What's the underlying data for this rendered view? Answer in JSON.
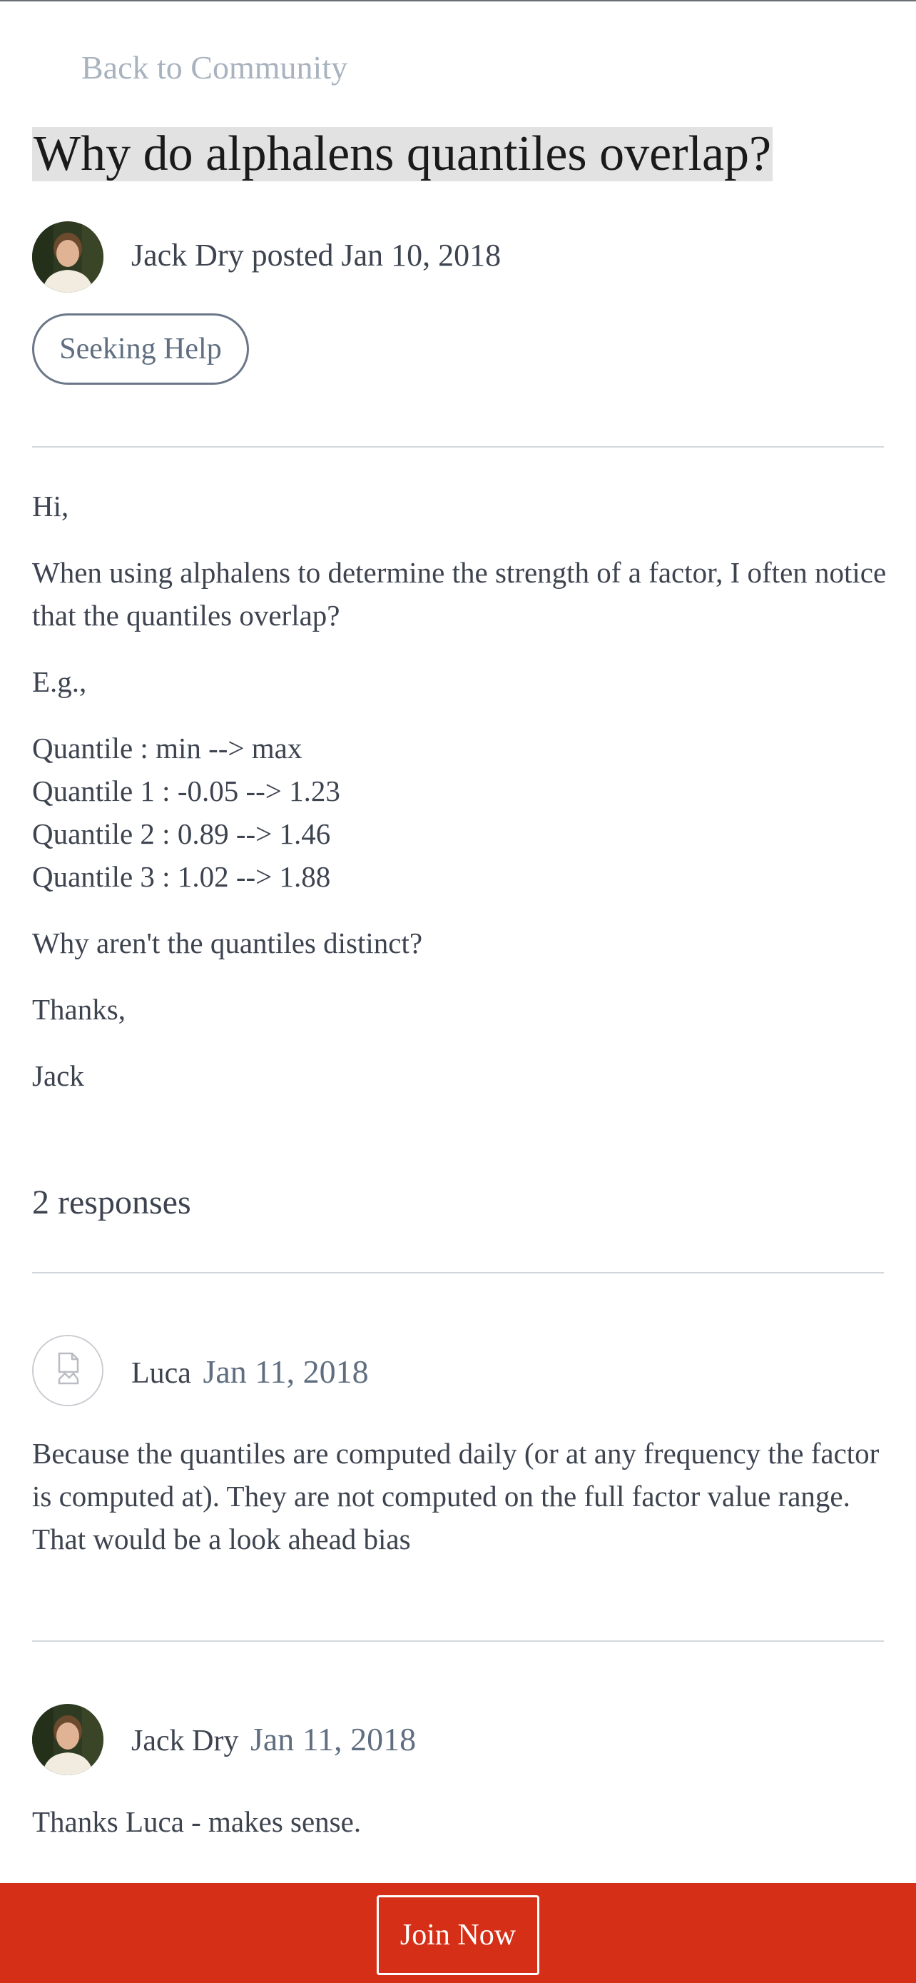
{
  "nav": {
    "back_label": "Back to Community"
  },
  "post": {
    "title": "Why do alphalens quantiles overlap?",
    "byline": "Jack Dry posted Jan 10, 2018",
    "tag": "Seeking Help",
    "paragraphs": {
      "p0": "Hi,",
      "p1": "When using alphalens to determine the strength of a factor, I often notice that the quantiles overlap?",
      "p2": "E.g.,",
      "p3_lines": [
        "Quantile : min --> max",
        "Quantile 1 : -0.05 --> 1.23",
        "Quantile 2 : 0.89 --> 1.46",
        "Quantile 3 : 1.02 --> 1.88"
      ],
      "p4": "Why aren't the quantiles distinct?",
      "p5": "Thanks,",
      "p6": "Jack"
    }
  },
  "responses": {
    "heading": "2 responses",
    "items": [
      {
        "author": "Luca",
        "date": "Jan 11, 2018",
        "text": "Because the quantiles are computed daily (or at any frequency the factor is computed at). They are not computed on the full factor value range. That would be a look ahead bias",
        "avatar": "broken-image-icon"
      },
      {
        "author": "Jack Dry",
        "date": "Jan 11, 2018",
        "text": "Thanks Luca - makes sense.",
        "avatar": "user-photo"
      }
    ]
  },
  "footer": {
    "join_label": "Join Now"
  },
  "colors": {
    "join_bar": "#d52f17",
    "title_highlight": "#e2e2e2",
    "muted_link": "#a8b3bf"
  }
}
